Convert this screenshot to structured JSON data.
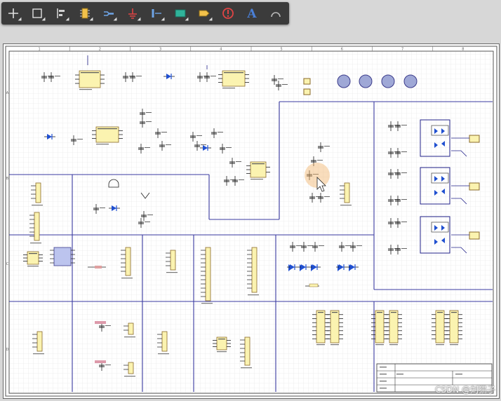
{
  "toolbar": {
    "tools": [
      {
        "name": "crosshair-icon",
        "color": "#e0e0e0"
      },
      {
        "name": "select-rectangle-icon",
        "color": "#e0e0e0"
      },
      {
        "name": "align-icon",
        "color": "#d0d0d0"
      },
      {
        "name": "component-icon",
        "color": "#f2c14a"
      },
      {
        "name": "wire-icon",
        "color": "#6ea4e6"
      },
      {
        "name": "ground-icon",
        "color": "#e04444"
      },
      {
        "name": "bus-icon",
        "color": "#6ea4e6"
      },
      {
        "name": "sheet-symbol-icon",
        "color": "#2fb39a"
      },
      {
        "name": "port-icon",
        "color": "#f2c14a"
      },
      {
        "name": "no-erc-icon",
        "color": "#e04444"
      },
      {
        "name": "text-icon",
        "color": "#4a7fd6"
      },
      {
        "name": "arc-icon",
        "color": "#b8b8b8"
      }
    ]
  },
  "sheet": {
    "border_labels": {
      "top": [
        "1",
        "2",
        "3",
        "4",
        "5",
        "6",
        "7",
        "8"
      ],
      "side": [
        "A",
        "B",
        "C",
        "D"
      ]
    },
    "colors": {
      "grid": "#e3e3e3",
      "border": "#3a3aa0",
      "component_fill": "#fbf3b0",
      "component_stroke": "#8a6a2a",
      "wire": "#22228a",
      "pin": "#1e1e1e",
      "diode": "#1f4fd0"
    }
  },
  "watermark": "CSDN @刘猫子"
}
